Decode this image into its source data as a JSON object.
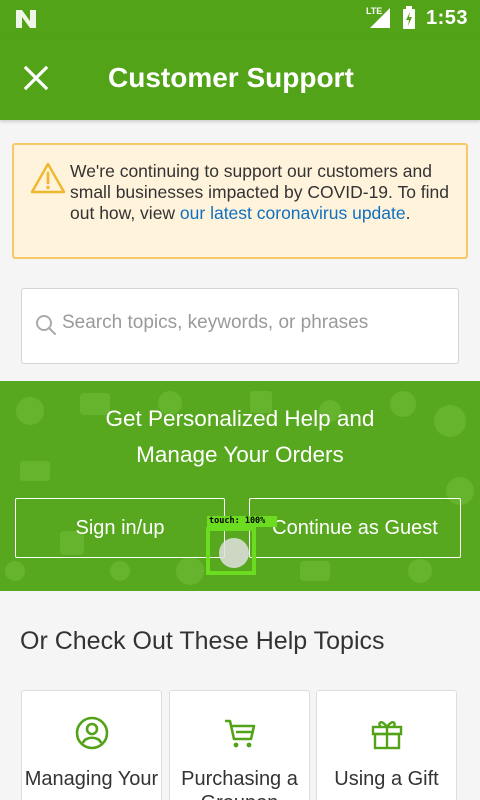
{
  "status_bar": {
    "time": "1:53",
    "network": "LTE"
  },
  "toolbar": {
    "title": "Customer Support"
  },
  "notice": {
    "text_before": "We're continuing to support our customers and small businesses impacted by COVID-19. To find out how, view ",
    "link_text": "our latest coronavirus update",
    "text_after": "."
  },
  "search": {
    "placeholder": "Search topics, keywords, or phrases",
    "value": ""
  },
  "personalized_help": {
    "heading_line1": "Get Personalized Help and",
    "heading_line2": "Manage Your Orders",
    "sign_in_label": "Sign in/up",
    "guest_label": "Continue as Guest"
  },
  "touch_indicator": {
    "label": "touch: 100%"
  },
  "help_topics": {
    "heading": "Or Check Out These Help Topics",
    "cards": [
      {
        "label": "Managing Your",
        "icon": "account-icon"
      },
      {
        "label": "Purchasing a Groupon",
        "icon": "cart-icon"
      },
      {
        "label": "Using a Gift",
        "icon": "gift-icon"
      }
    ]
  },
  "colors": {
    "brand_green": "#53a318",
    "band_green": "#58a81f",
    "link_blue": "#0f70c2",
    "notice_bg": "#fff3dc",
    "notice_border": "#f6c869",
    "touch_green": "#6cdc21"
  }
}
